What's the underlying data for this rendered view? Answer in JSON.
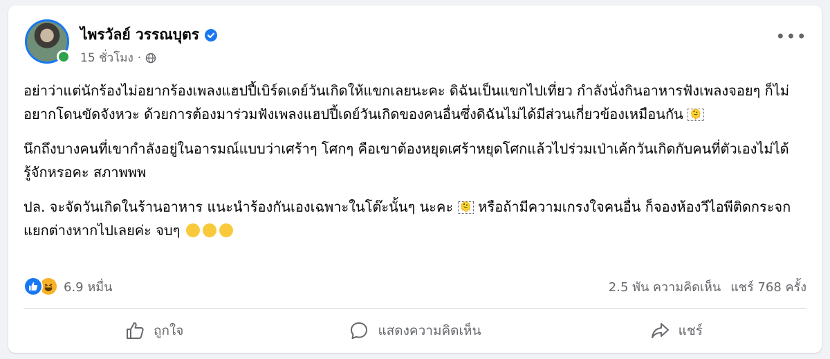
{
  "post": {
    "author": "ไพรวัลย์ วรรณบุตร",
    "timestamp": "15 ชั่วโมง",
    "paragraphs": [
      "อย่าว่าแต่นักร้องไม่อยากร้องเพลงแฮปปี้เบิร์ดเดย์วันเกิดให้แขกเลยนะคะ ดิฉันเป็นแขกไปเที่ยว กำลังนั่งกินอาหารฟังเพลงจอยๆ ก็ไม่อยากโดนขัดจังหวะ ด้วยการต้องมาร่วมฟังเพลงแฮปปี้เดย์วันเกิดของคนอื่นซึ่งดิฉันไม่ได้มีส่วนเกี่ยวข้องเหมือนกัน",
      "นึกถึงบางคนที่เขากำลังอยู่ในอารมณ์แบบว่าเศร้าๆ โศกๆ คือเขาต้องหยุดเศร้าหยุดโศกแล้วไปร่วมเป่าเค้กวันเกิดกับคนที่ตัวเองไม่ได้รู้จักหรอคะ สภาพพพ",
      "ปล. จะจัดวันเกิดในร้านอาหาร แนะนำร้องกันเองเฉพาะในโต๊ะนั้นๆ นะคะ",
      "หรือถ้ามีความเกรงใจคนอื่น ก็จองห้องวีไอพีติดกระจกแยกต่างหากไปเลยค่ะ จบๆ"
    ],
    "unknown_glyph": "🫠"
  },
  "reactions": {
    "count": "6.9 หมื่น",
    "comments": "2.5 พัน ความคิดเห็น",
    "shares": "แชร์ 768 ครั้ง"
  },
  "actions": {
    "like": "ถูกใจ",
    "comment": "แสดงความคิดเห็น",
    "share": "แชร์"
  },
  "icons": {
    "verified": "verified-badge-icon",
    "globe": "globe-icon",
    "more": "more-options-icon",
    "like": "thumbs-up-icon",
    "comment": "comment-bubble-icon",
    "share": "share-arrow-icon"
  },
  "colors": {
    "accent": "#1877f2",
    "online": "#31a24c",
    "muted_text": "#65676b",
    "haha": "#f7b125"
  }
}
